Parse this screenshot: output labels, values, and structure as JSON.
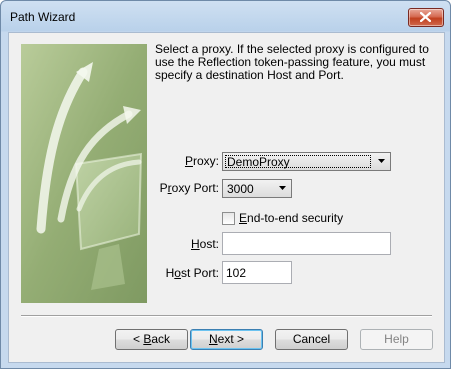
{
  "window": {
    "title": "Path Wizard"
  },
  "description": "Select a proxy. If the selected proxy is configured to use the Reflection token-passing feature, you must specify a destination Host and Port.",
  "form": {
    "proxy": {
      "label_u": "P",
      "label_rest": "roxy:",
      "value": "DemoProxy"
    },
    "proxy_port": {
      "label_pre": "P",
      "label_u": "r",
      "label_rest": "oxy Port:",
      "value": "3000"
    },
    "end_to_end": {
      "label_u": "E",
      "label_rest": "nd-to-end security",
      "checked": false
    },
    "host": {
      "label_u": "H",
      "label_rest": "ost:",
      "value": ""
    },
    "host_port": {
      "label_pre": "H",
      "label_u": "o",
      "label_rest": "st Port:",
      "value": "102"
    }
  },
  "buttons": {
    "back": {
      "prefix": "< ",
      "u": "B",
      "rest": "ack"
    },
    "next": {
      "u": "N",
      "rest": "ext >"
    },
    "cancel": {
      "label": "Cancel"
    },
    "help": {
      "label": "Help",
      "enabled": false
    }
  },
  "icons": [
    "close-icon",
    "dropdown-arrow-icon",
    "wizard-banner-art"
  ]
}
